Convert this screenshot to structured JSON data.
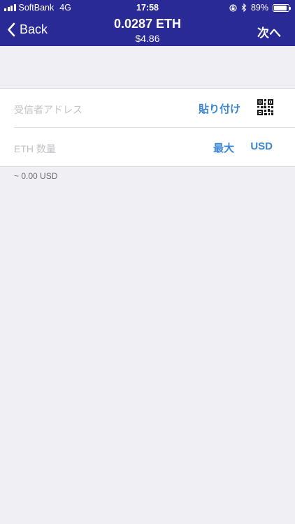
{
  "status_bar": {
    "carrier": "SoftBank",
    "network": "4G",
    "time": "17:58",
    "battery": "89%",
    "battery_level": 0.89
  },
  "nav": {
    "back_label": "Back",
    "title": "0.0287 ETH",
    "subtitle": "$4.86",
    "next_label": "次へ"
  },
  "form": {
    "recipient_placeholder": "受信者アドレス",
    "paste_label": "貼り付け",
    "qr_icon": "qr-code-icon",
    "amount_placeholder": "ETH 数量",
    "max_label": "最大",
    "currency_label": "USD"
  },
  "conversion": "~ 0.00 USD",
  "colors": {
    "nav_bg": "#2a2a96",
    "accent": "#3a86d4",
    "page_bg": "#efeff4"
  }
}
